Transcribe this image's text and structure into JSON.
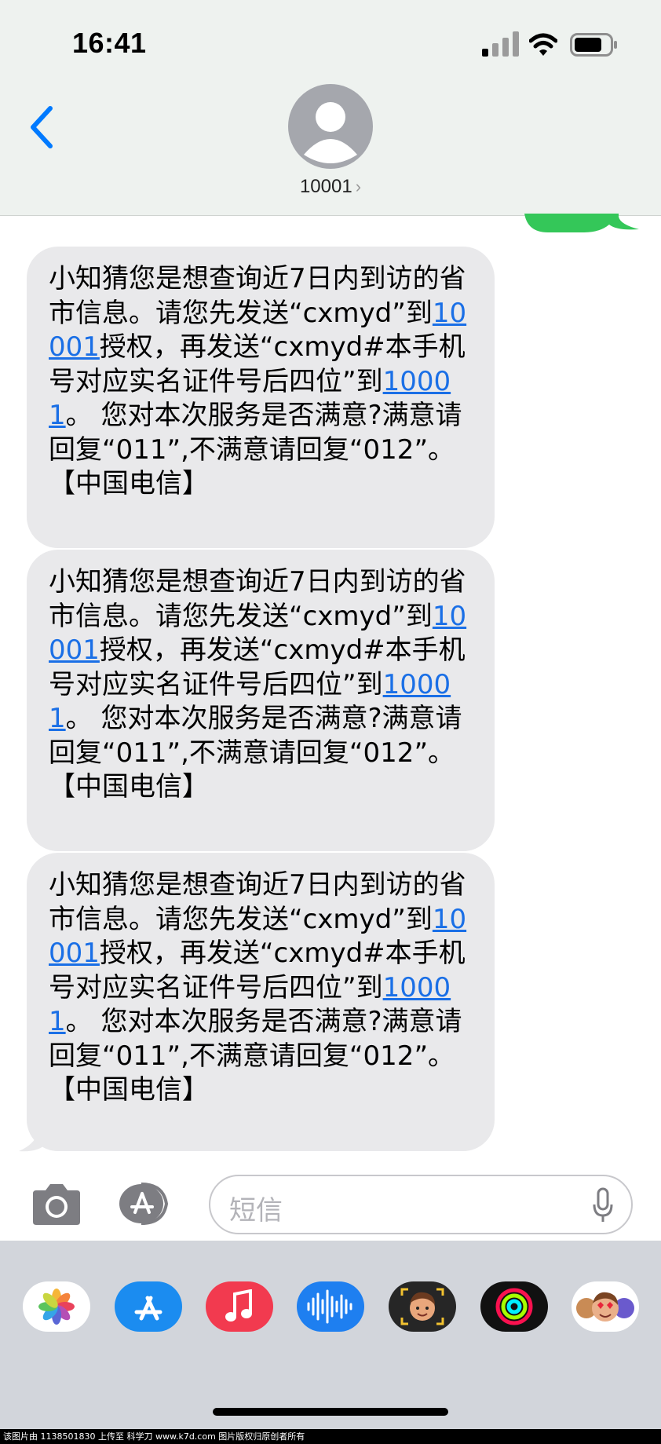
{
  "status_bar": {
    "time": "16:41"
  },
  "header": {
    "contact_name": "10001",
    "chevron": "›"
  },
  "messages": [
    {
      "segments": [
        "小知猜您是想查询近7日内到访的省市信息。请您先发送“cxmyd”到",
        "10001",
        "授权，再发送“cxmyd#本手机号对应实名证件号后四位”到",
        "10001",
        "。 您对本次服务是否满意?满意请回复“011”,不满意请回复“012”。【中国电信】"
      ]
    },
    {
      "segments": [
        "小知猜您是想查询近7日内到访的省市信息。请您先发送“cxmyd”到",
        "10001",
        "授权，再发送“cxmyd#本手机号对应实名证件号后四位”到",
        "10001",
        "。 您对本次服务是否满意?满意请回复“011”,不满意请回复“012”。【中国电信】"
      ]
    },
    {
      "segments": [
        "小知猜您是想查询近7日内到访的省市信息。请您先发送“cxmyd”到",
        "10001",
        "授权，再发送“cxmyd#本手机号对应实名证件号后四位”到",
        "10001",
        "。 您对本次服务是否满意?满意请回复“011”,不满意请回复“012”。【中国电信】"
      ]
    }
  ],
  "input": {
    "placeholder": "短信"
  },
  "app_drawer": {
    "icons": [
      "photos-icon",
      "app-store-icon",
      "music-icon",
      "audio-message-icon",
      "memoji-camera-icon",
      "fitness-icon",
      "memoji-stickers-icon"
    ]
  },
  "colors": {
    "header_bg": "#eef2ef",
    "bubble_received": "#e9e9eb",
    "bubble_sent": "#34c759",
    "link": "#1a6fe6",
    "ios_blue": "#007aff",
    "drawer_bg": "#d2d5db"
  },
  "footer": {
    "watermark": "该图片由 1138501830 上传至 科学刀 www.k7d.com 图片版权归原创者所有"
  }
}
